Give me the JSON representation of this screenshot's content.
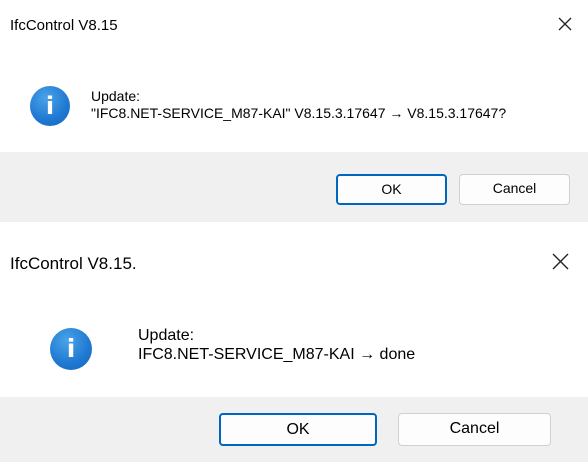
{
  "dialogs": [
    {
      "title": "IfcControl V8.15",
      "message_heading": "Update:",
      "message_detail": "\"IFC8.NET-SERVICE_M87-KAI\" V8.15.3.17647 → V8.15.3.17647?",
      "icon": "info-icon",
      "close_icon": "close-icon",
      "ok_label": "OK",
      "cancel_label": "Cancel",
      "default_button": "OK"
    },
    {
      "title": "IfcControl V8.15.",
      "message_heading": "Update:",
      "message_detail": "IFC8.NET-SERVICE_M87-KAI → done",
      "icon": "info-icon",
      "close_icon": "close-icon",
      "ok_label": "OK",
      "cancel_label": "Cancel",
      "default_button": "OK"
    }
  ],
  "colors": {
    "footer_bg": "#f0f0f0",
    "icon_blue": "#1f78d1",
    "default_button_border": "#0067c0"
  }
}
